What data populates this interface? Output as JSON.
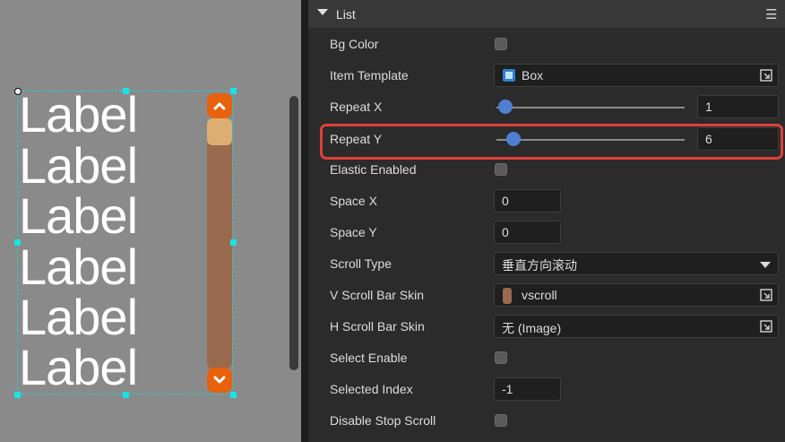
{
  "canvas": {
    "labels": [
      "Label",
      "Label",
      "Label",
      "Label",
      "Label",
      "Label"
    ]
  },
  "panel": {
    "title": "List",
    "menu_icon": "hamburger-icon",
    "rows": {
      "bg_color": {
        "label": "Bg Color"
      },
      "item_template": {
        "label": "Item Template",
        "value": "Box"
      },
      "repeat_x": {
        "label": "Repeat X",
        "value": "1"
      },
      "repeat_y": {
        "label": "Repeat Y",
        "value": "6"
      },
      "elastic_enabled": {
        "label": "Elastic Enabled"
      },
      "space_x": {
        "label": "Space X",
        "value": "0"
      },
      "space_y": {
        "label": "Space Y",
        "value": "0"
      },
      "scroll_type": {
        "label": "Scroll Type",
        "value": "垂直方向滚动"
      },
      "v_scroll_bar_skin": {
        "label": "V Scroll Bar Skin",
        "value": "vscroll"
      },
      "h_scroll_bar_skin": {
        "label": "H Scroll Bar Skin",
        "value": "无 (Image)"
      },
      "select_enable": {
        "label": "Select Enable"
      },
      "selected_index": {
        "label": "Selected Index",
        "value": "-1"
      },
      "disable_stop_scroll": {
        "label": "Disable Stop Scroll"
      }
    }
  },
  "colors": {
    "highlight": "#e0403a",
    "scrollbar_button": "#e8620d",
    "scrollbar_track": "#9a6a4f",
    "scrollbar_thumb": "#dcae72",
    "slider_knob": "#4e7fd0",
    "selection_border": "#1ecfcf"
  }
}
